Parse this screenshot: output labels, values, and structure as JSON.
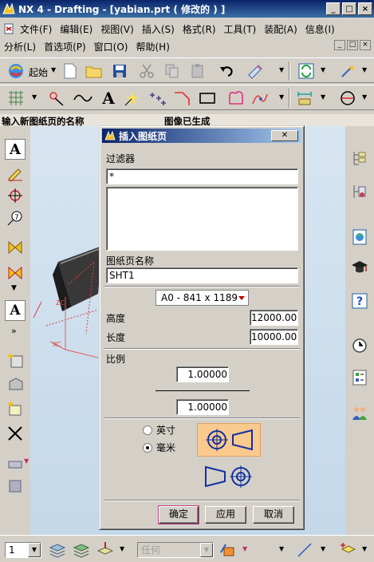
{
  "window": {
    "title": "NX 4 - Drafting - [yabian.prt ( 修改的 ) ]",
    "buttons": [
      "_",
      "□",
      "×"
    ]
  },
  "menu1": [
    "文件(F)",
    "编辑(E)",
    "视图(V)",
    "插入(S)",
    "格式(R)",
    "工具(T)",
    "装配(A)",
    "信息(I)"
  ],
  "menu2": [
    "分析(L)",
    "首选项(P)",
    "窗口(O)",
    "帮助(H)"
  ],
  "mdi_buttons": [
    "_",
    "□",
    "×"
  ],
  "toolbar1": {
    "start_label": "起始"
  },
  "status": {
    "prompt": "输入新图纸页的名称",
    "message": "图像已生成"
  },
  "bottom": {
    "layer_value": "1",
    "filter_value": "任何"
  },
  "dialog": {
    "title": "插入图纸页",
    "close_label": "✕",
    "filter_label": "过滤器",
    "filter_value": "*",
    "sheet_name_label": "图纸页名称",
    "sheet_name_value": "SHT1",
    "size_value": "A0 - 841 x 1189",
    "height_label": "高度",
    "height_value": "12000.00",
    "length_label": "长度",
    "length_value": "10000.00",
    "scale_label": "比例",
    "scale_num": "1.00000",
    "scale_den": "1.00000",
    "units": [
      {
        "label": "英寸",
        "selected": false
      },
      {
        "label": "毫米",
        "selected": true
      }
    ],
    "buttons": {
      "ok": "确定",
      "apply": "应用",
      "cancel": "取消"
    }
  },
  "colors": {
    "title_bar": "#0a246a",
    "highlight": "#f9c98d",
    "graphics_bg": "#c4d8ea"
  }
}
